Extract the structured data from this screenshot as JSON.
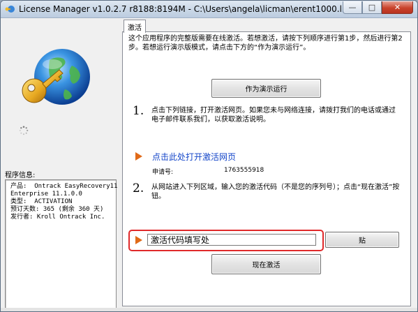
{
  "window": {
    "title": "License Manager v1.0.2.7 r8188:8194M - C:\\Users\\angela\\licman\\erent1000.lic",
    "buttons": {
      "minimize": "—",
      "maximize": "□",
      "close": "✕"
    }
  },
  "left_panel": {
    "program_info_label": "程序信息:",
    "program_info_lines": [
      "产品:  Ontrack EasyRecovery11",
      "Enterprise 11.1.0.0",
      "类型:  ACTIVATION",
      "预订天数: 365 (剩余 360 天)",
      "发行者: Kroll Ontrack Inc."
    ]
  },
  "tabs": [
    {
      "label": "激活"
    }
  ],
  "activation": {
    "intro": "这个应用程序的完整版需要在线激活。若想激活，请按下列顺序进行第1步，然后进行第2步。若想运行演示版模式，请点击下方的“作为演示运行”。",
    "demo_button": "作为演示运行",
    "step1_number": "1.",
    "step1_text": "点击下列链接，打开激活网页。如果您未与网络连接，请拨打我们的电话或通过电子邮件联系我们，以获取激活说明。",
    "link_text": "点击此处打开激活网页",
    "request_label": "申请号:",
    "request_number": "1763555918",
    "step2_number": "2.",
    "step2_text": "从网站进入下列区域，输入您的激活代码（不是您的序列号）；点击“现在激活”按钮。",
    "code_input_value": "激活代码填写处",
    "paste_button": "贴",
    "activate_button": "现在激活"
  },
  "colors": {
    "accent_arrow": "#e06a18",
    "link": "#1446c9",
    "highlight": "#e0292a"
  }
}
